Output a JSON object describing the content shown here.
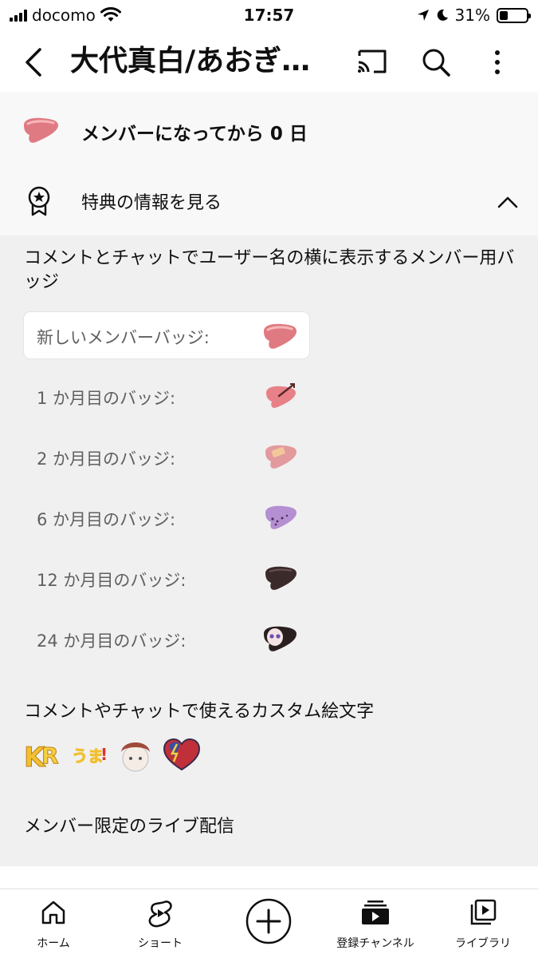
{
  "status_bar": {
    "carrier": "docomo",
    "time": "17:57",
    "battery": "31%",
    "battery_level": 0.31
  },
  "header": {
    "title": "大代真白/あおぎ…",
    "back_icon": "chevron-left-icon",
    "cast_icon": "cast-icon",
    "search_icon": "search-icon",
    "more_icon": "more-vertical-icon"
  },
  "membership": {
    "status_text": "メンバーになってから 0 日",
    "perks_label": "特典の情報を見る",
    "perks_icon": "award-badge-icon",
    "collapse_icon": "chevron-up-icon"
  },
  "perks": {
    "badges_description": "コメントとチャットでユーザー名の横に表示するメンバー用バッジ",
    "badges": [
      {
        "label": "新しいメンバーバッジ:",
        "icon": "liver-badge-new",
        "color": "#e07a82"
      },
      {
        "label": "1 か月目のバッジ:",
        "icon": "liver-badge-arrow",
        "color": "#e88088"
      },
      {
        "label": "2 か月目のバッジ:",
        "icon": "liver-badge-bandage",
        "color": "#e39a9d"
      },
      {
        "label": "6 か月目のバッジ:",
        "icon": "liver-badge-purple",
        "color": "#b48fd1"
      },
      {
        "label": "12 か月目のバッジ:",
        "icon": "liver-badge-dark",
        "color": "#3a2a2a"
      },
      {
        "label": "24 か月目のバッジ:",
        "icon": "liver-badge-face",
        "color": "#2a1f1f"
      }
    ],
    "emoji_title": "コメントやチャットで使えるカスタム絵文字",
    "emojis": [
      "kr-emoji",
      "uta-emoji",
      "character-emoji",
      "heart-lightning-emoji"
    ],
    "live_title": "メンバー限定のライブ配信"
  },
  "bottom_nav": {
    "items": [
      {
        "label": "ホーム",
        "icon": "home-icon"
      },
      {
        "label": "ショート",
        "icon": "shorts-icon"
      },
      {
        "label": "",
        "icon": "create-plus-icon"
      },
      {
        "label": "登録チャンネル",
        "icon": "subscriptions-icon"
      },
      {
        "label": "ライブラリ",
        "icon": "library-icon"
      }
    ]
  }
}
